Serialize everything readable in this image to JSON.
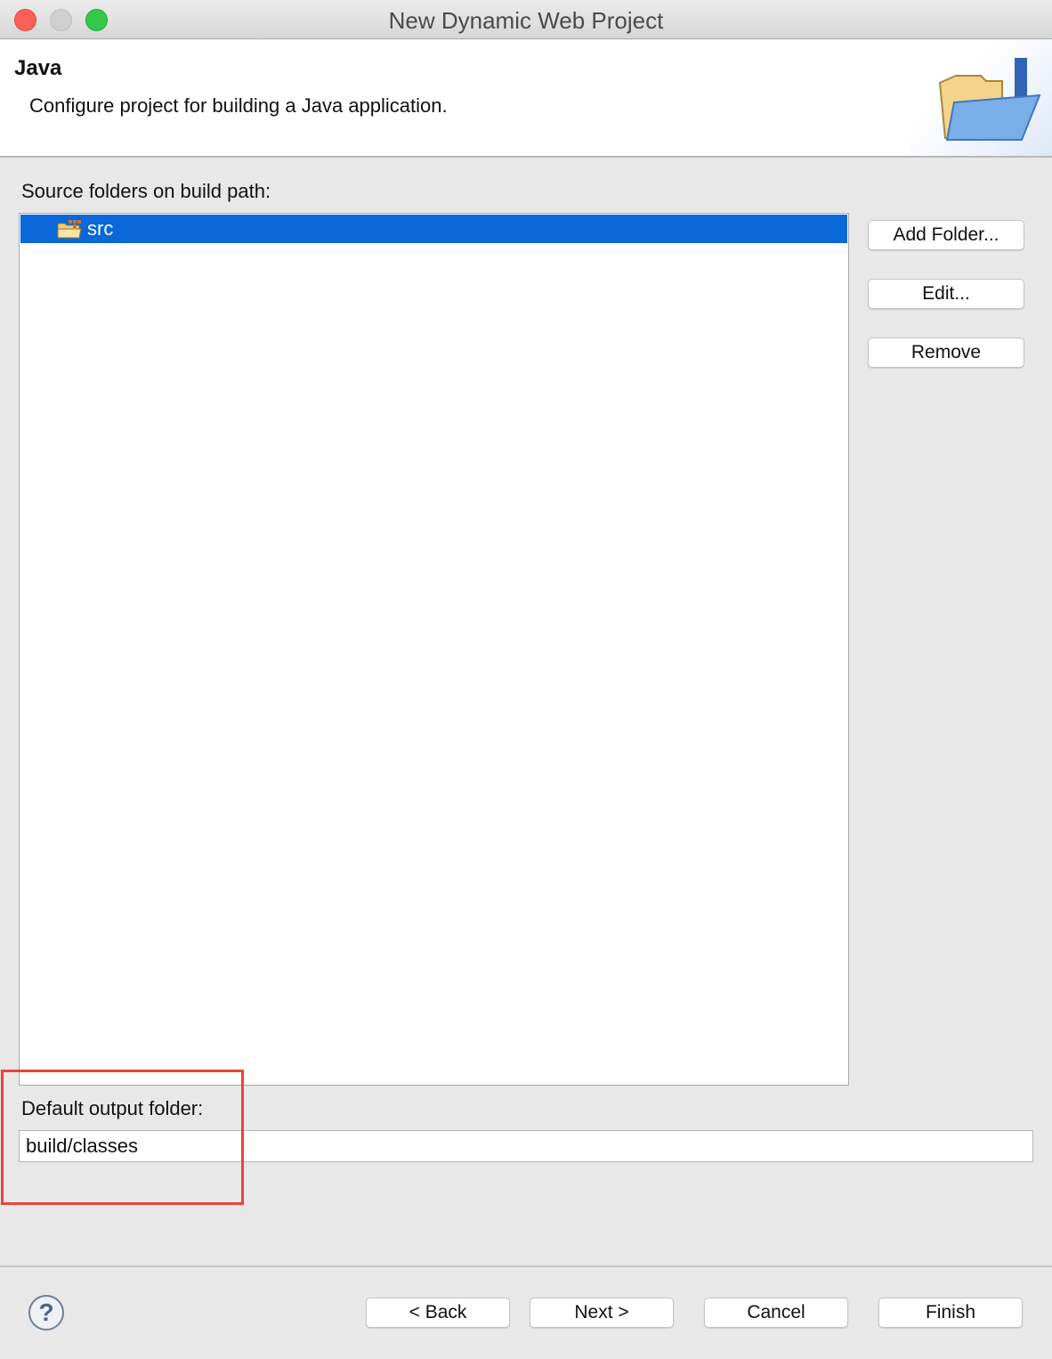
{
  "window": {
    "title": "New Dynamic Web Project"
  },
  "header": {
    "title": "Java",
    "description": "Configure project for building a Java application.",
    "icon": "java-folder-icon"
  },
  "source_folders": {
    "label": "Source folders on build path:",
    "items": [
      {
        "label": "src",
        "icon": "package-folder-icon",
        "selected": true
      }
    ]
  },
  "side_buttons": {
    "add_folder": "Add Folder...",
    "edit": "Edit...",
    "remove": "Remove"
  },
  "output": {
    "label": "Default output folder:",
    "value": "build/classes"
  },
  "footer": {
    "help_glyph": "?",
    "back": "< Back",
    "next": "Next >",
    "cancel": "Cancel",
    "finish": "Finish"
  },
  "colors": {
    "selection": "#0a68d8",
    "highlight": "#e8453c"
  }
}
